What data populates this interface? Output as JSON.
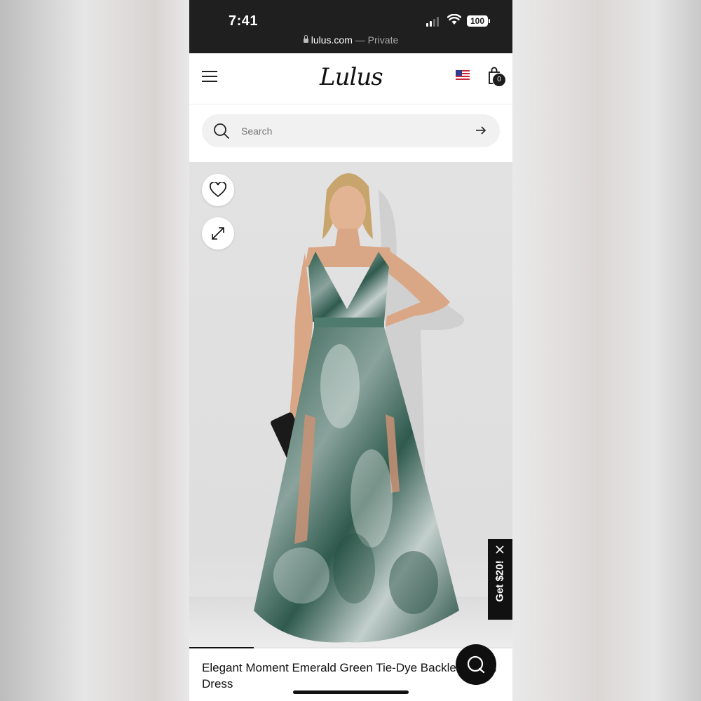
{
  "status_bar": {
    "time": "7:41",
    "battery": "100"
  },
  "browser": {
    "domain": "lulus.com",
    "separator": "—",
    "mode": "Private"
  },
  "header": {
    "logo": "Lulus",
    "cart_count": "0",
    "flag": "us-flag-icon"
  },
  "search": {
    "placeholder": "Search"
  },
  "product": {
    "title": "Elegant Moment Emerald Green Tie-Dye Backless Maxi Dress",
    "image_description_icons": [
      "heart-icon",
      "expand-icon"
    ],
    "gallery_progress": 0.2
  },
  "promo": {
    "label": "Get $20!"
  },
  "colors": {
    "status_bar": "#1f1f1f",
    "dress_green": "#2f5a4d",
    "tab_black": "#111111"
  }
}
